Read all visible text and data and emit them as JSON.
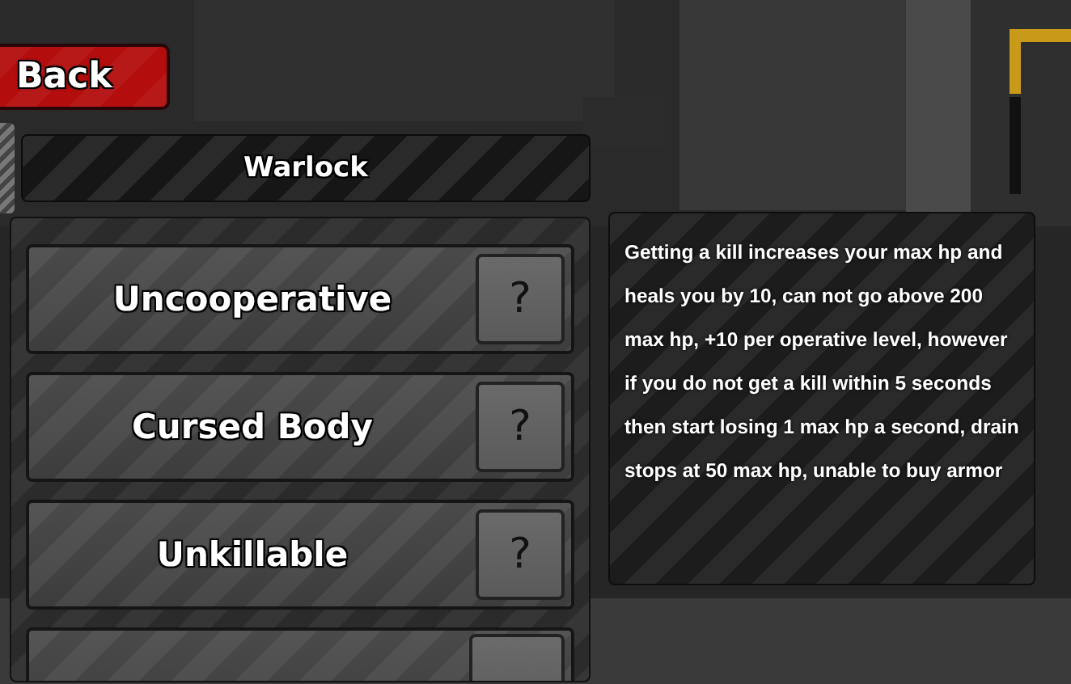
{
  "back_button": {
    "label": "Back"
  },
  "class_bar": {
    "title": "Warlock"
  },
  "perks": [
    {
      "kind": "perk",
      "label": "Uncooperative",
      "help": "?"
    },
    {
      "kind": "perk",
      "label": "Cursed Body",
      "help": "?"
    },
    {
      "kind": "perk",
      "label": "Unkillable",
      "help": "?"
    },
    {
      "kind": "cut"
    }
  ],
  "description": {
    "text": "Getting a kill increases your max hp and heals you by 10, can not go above 200 max hp, +10 per operative level, however if you do not get a kill within 5 seconds then start losing 1 max hp a second, drain stops at 50 max hp, unable to buy armor"
  }
}
